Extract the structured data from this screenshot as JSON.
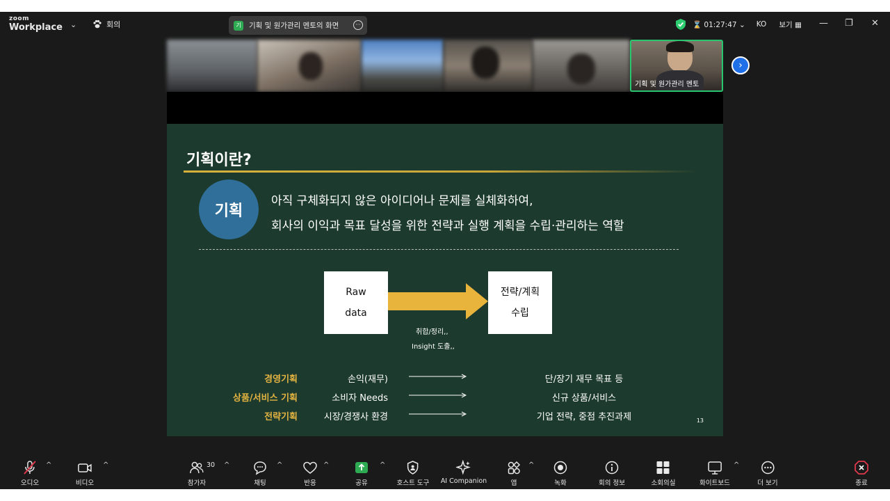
{
  "app": {
    "logo_top": "zoom",
    "logo_bottom": "Workplace",
    "meeting_menu": "회의"
  },
  "share_pill": {
    "badge": "기",
    "text": "기획 및 원가관리 멘토의 화면"
  },
  "status": {
    "timer": "01:27:47",
    "language": "KO",
    "view_label": "보기"
  },
  "thumbnails": {
    "active_label": "기획 및 원가관리 멘토"
  },
  "slide": {
    "title": "기획이란?",
    "circle_label": "기획",
    "definition_line1": "아직 구체화되지 않은 아이디어나 문제를 실체화하여,",
    "definition_line2": "회사의 이익과 목표 달성을 위한 전략과 실행 계획을 수립·관리하는 역할",
    "box_left_line1": "Raw",
    "box_left_line2": "data",
    "arrow_caption1": "취합/정리,,",
    "arrow_caption2": "Insight 도출,,",
    "box_right_line1": "전략/계획",
    "box_right_line2": "수립",
    "rows": [
      {
        "category": "경영기획",
        "input": "손익(재무)",
        "output": "단/장기 재무 목표 등"
      },
      {
        "category": "상품/서비스 기획",
        "input": "소비자 Needs",
        "output": "신규 상품/서비스"
      },
      {
        "category": "전략기획",
        "input": "시장/경쟁사 환경",
        "output": "기업 전략, 중점 추진과제"
      }
    ],
    "page_number": "13",
    "colors": {
      "background": "#1c3a2e",
      "accent": "#e3b341",
      "circle": "#2f6f9a"
    }
  },
  "toolbar": {
    "audio": "오디오",
    "video": "비디오",
    "participants": "참가자",
    "participant_count": "30",
    "chat": "채팅",
    "reactions": "반응",
    "share": "공유",
    "host_tools": "호스트 도구",
    "ai_companion": "AI Companion",
    "apps": "앱",
    "record": "녹화",
    "meeting_info": "회의 정보",
    "breakout": "소회의실",
    "whiteboard": "화이트보드",
    "more": "더 보기",
    "end": "종료",
    "share_color": "#2eaa52",
    "end_color": "#e0384b"
  }
}
